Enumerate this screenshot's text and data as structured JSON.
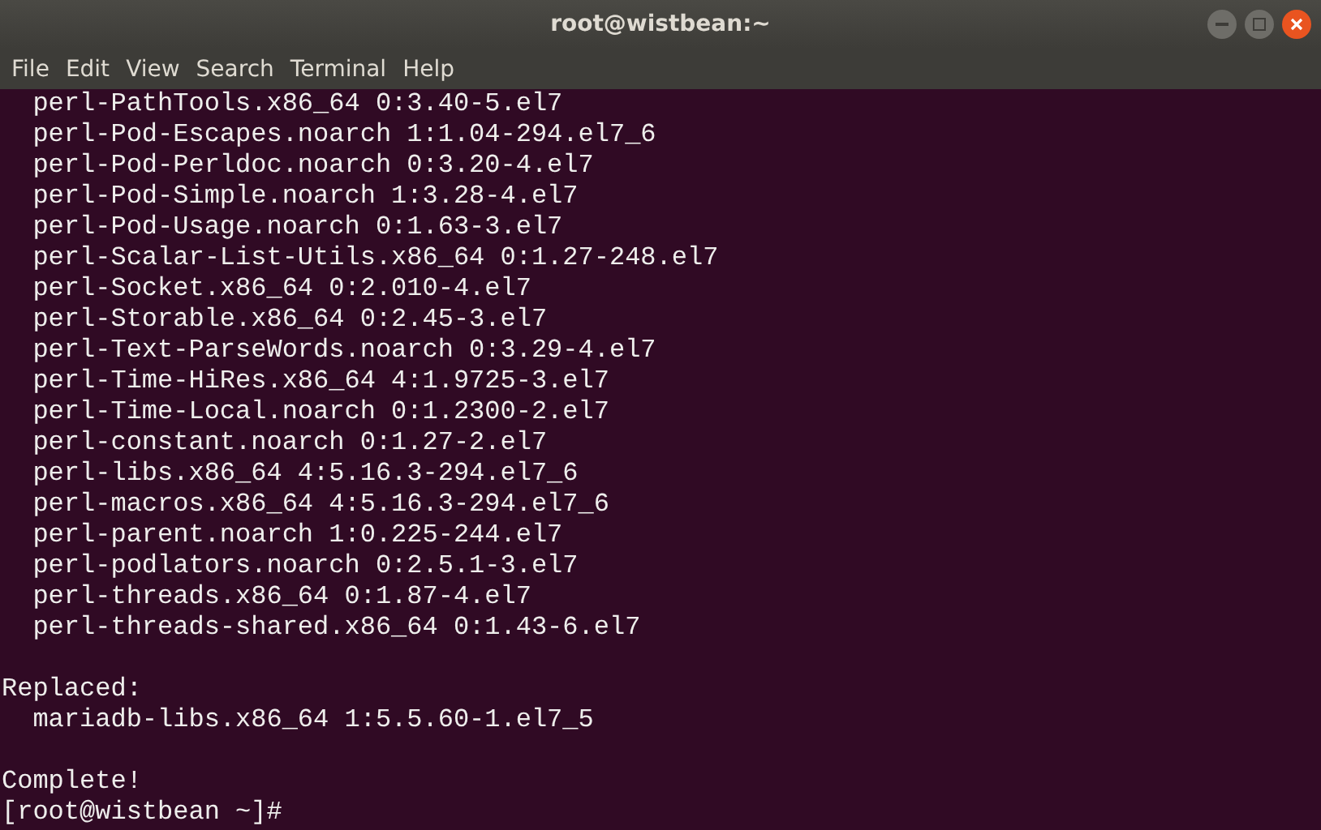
{
  "window": {
    "title": "root@wistbean:~"
  },
  "menu": [
    "File",
    "Edit",
    "View",
    "Search",
    "Terminal",
    "Help"
  ],
  "terminal": {
    "lines": [
      {
        "kind": "text",
        "text": "  perl-PathTools.x86_64 0:3.40-5.el7"
      },
      {
        "kind": "text",
        "text": "  perl-Pod-Escapes.noarch 1:1.04-294.el7_6"
      },
      {
        "kind": "text",
        "text": "  perl-Pod-Perldoc.noarch 0:3.20-4.el7"
      },
      {
        "kind": "text",
        "text": "  perl-Pod-Simple.noarch 1:3.28-4.el7"
      },
      {
        "kind": "text",
        "text": "  perl-Pod-Usage.noarch 0:1.63-3.el7"
      },
      {
        "kind": "text",
        "text": "  perl-Scalar-List-Utils.x86_64 0:1.27-248.el7"
      },
      {
        "kind": "text",
        "text": "  perl-Socket.x86_64 0:2.010-4.el7"
      },
      {
        "kind": "text",
        "text": "  perl-Storable.x86_64 0:2.45-3.el7"
      },
      {
        "kind": "text",
        "text": "  perl-Text-ParseWords.noarch 0:3.29-4.el7"
      },
      {
        "kind": "text",
        "text": "  perl-Time-HiRes.x86_64 4:1.9725-3.el7"
      },
      {
        "kind": "text",
        "text": "  perl-Time-Local.noarch 0:1.2300-2.el7"
      },
      {
        "kind": "text",
        "text": "  perl-constant.noarch 0:1.27-2.el7"
      },
      {
        "kind": "text",
        "text": "  perl-libs.x86_64 4:5.16.3-294.el7_6"
      },
      {
        "kind": "text",
        "text": "  perl-macros.x86_64 4:5.16.3-294.el7_6"
      },
      {
        "kind": "text",
        "text": "  perl-parent.noarch 1:0.225-244.el7"
      },
      {
        "kind": "text",
        "text": "  perl-podlators.noarch 0:2.5.1-3.el7"
      },
      {
        "kind": "text",
        "text": "  perl-threads.x86_64 0:1.87-4.el7"
      },
      {
        "kind": "text",
        "text": "  perl-threads-shared.x86_64 0:1.43-6.el7"
      },
      {
        "kind": "blank"
      },
      {
        "kind": "text",
        "text": "Replaced:"
      },
      {
        "kind": "text",
        "text": "  mariadb-libs.x86_64 1:5.5.60-1.el7_5"
      },
      {
        "kind": "blank"
      },
      {
        "kind": "text",
        "text": "Complete!"
      },
      {
        "kind": "text",
        "text": "[root@wistbean ~]#"
      }
    ]
  }
}
